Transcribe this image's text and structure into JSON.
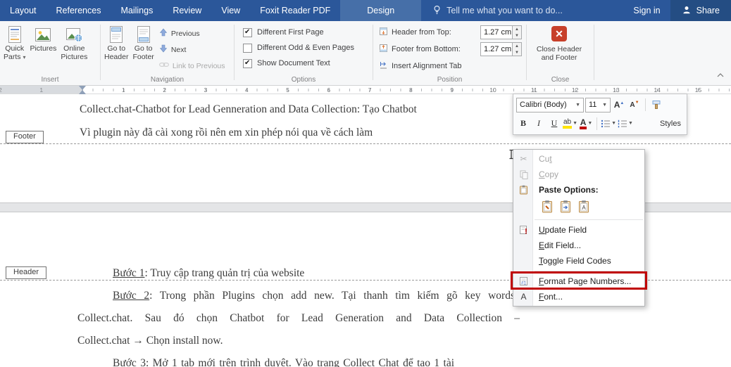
{
  "colors": {
    "titlebar_blue": "#2b579a",
    "active_tab_blue": "#466fa8",
    "annotation_red": "#c00000",
    "close_icon_red": "#c7402a",
    "ribbon_bg": "#f6f7f8"
  },
  "icons": {
    "lightbulb": "tell-me bulb",
    "share_person": "person silhouette",
    "scissors": "✂",
    "caret_down": "▾",
    "check": "✔",
    "chevron_up_collapse": "ribbon collapse chevron"
  },
  "tab_bar": {
    "tabs": [
      "Layout",
      "References",
      "Mailings",
      "Review",
      "View",
      "Foxit Reader PDF",
      "Design"
    ],
    "active_tab": "Design",
    "tell_me": "Tell me what you want to do...",
    "sign_in": "Sign in",
    "share": "Share"
  },
  "ribbon": {
    "insert": {
      "group_label": "Insert",
      "quick_parts_line1": "Quick",
      "quick_parts_line2": "Parts",
      "pictures": "Pictures",
      "online_line1": "Online",
      "online_line2": "Pictures"
    },
    "navigation": {
      "group_label": "Navigation",
      "go_to_header_line1": "Go to",
      "go_to_header_line2": "Header",
      "go_to_footer_line1": "Go to",
      "go_to_footer_line2": "Footer",
      "previous": "Previous",
      "next": "Next",
      "link_to_previous": "Link to Previous"
    },
    "options": {
      "group_label": "Options",
      "different_first_page": "Different First Page",
      "different_first_page_checked": true,
      "different_odd_even": "Different Odd & Even Pages",
      "different_odd_even_checked": false,
      "show_document_text": "Show Document Text",
      "show_document_text_checked": true
    },
    "position": {
      "group_label": "Position",
      "header_from_top": "Header from Top:",
      "header_from_top_value": "1.27 cm",
      "footer_from_bottom": "Footer from Bottom:",
      "footer_from_bottom_value": "1.27 cm",
      "insert_alignment_tab": "Insert Alignment Tab"
    },
    "close": {
      "group_label": "Close",
      "button_line1": "Close Header",
      "button_line2": "and Footer"
    }
  },
  "ruler": {
    "numbers": [
      "1",
      "2",
      "3",
      "4",
      "5",
      "6",
      "7",
      "8",
      "9",
      "10",
      "11",
      "12",
      "13",
      "14",
      "15"
    ],
    "margin_numbers": [
      "1",
      "2"
    ]
  },
  "document": {
    "p1_line1": "Collect.chat-Chatbot for Lead Genneration and Data Collection: Tạo Chatbot",
    "p1_line2": "Vì plugin này đã cài xong rồi nên em xin phép nói qua về cách làm",
    "footer_tag": "Footer",
    "header_tag": "Header",
    "step1_label": "Bước 1",
    "step1_text": ": Truy cập trang quản trị của website",
    "step2_label": "Bước 2",
    "step2_text": ": Trong phần Plugins chọn add new. Tại thanh tìm kiếm gõ key words",
    "line_collect1": "Collect.chat. Sau đó chọn Chatbot for Lead Generation and Data Collection –",
    "line_collect2": "Collect.chat → Chọn install now.",
    "step3_label": "Bước 3",
    "step3_text": ": Mở 1 tab mới trên trình duyệt. Vào trang Collect Chat để tạo 1 tài"
  },
  "mini_toolbar": {
    "font_name": "Calibri (Body)",
    "font_size": "11",
    "bold": "B",
    "italic": "I",
    "underline": "U",
    "highlight": "ab",
    "font_color": "A",
    "grow_font": "A",
    "shrink_font": "A",
    "styles": "Styles"
  },
  "context_menu": {
    "cut": {
      "label": "Cut",
      "accel": 2,
      "enabled": false
    },
    "copy": {
      "label": "Copy",
      "accel": 0,
      "enabled": false
    },
    "paste_options": {
      "label": "Paste Options:"
    },
    "update_field": {
      "label": "Update Field",
      "accel": 0
    },
    "edit_field": {
      "label": "Edit Field...",
      "accel": 0
    },
    "toggle_field_codes": {
      "label": "Toggle Field Codes",
      "accel": 0
    },
    "format_page_numbers": {
      "label": "Format Page Numbers...",
      "accel": 0
    },
    "font": {
      "label": "Font...",
      "accel": 0
    }
  }
}
